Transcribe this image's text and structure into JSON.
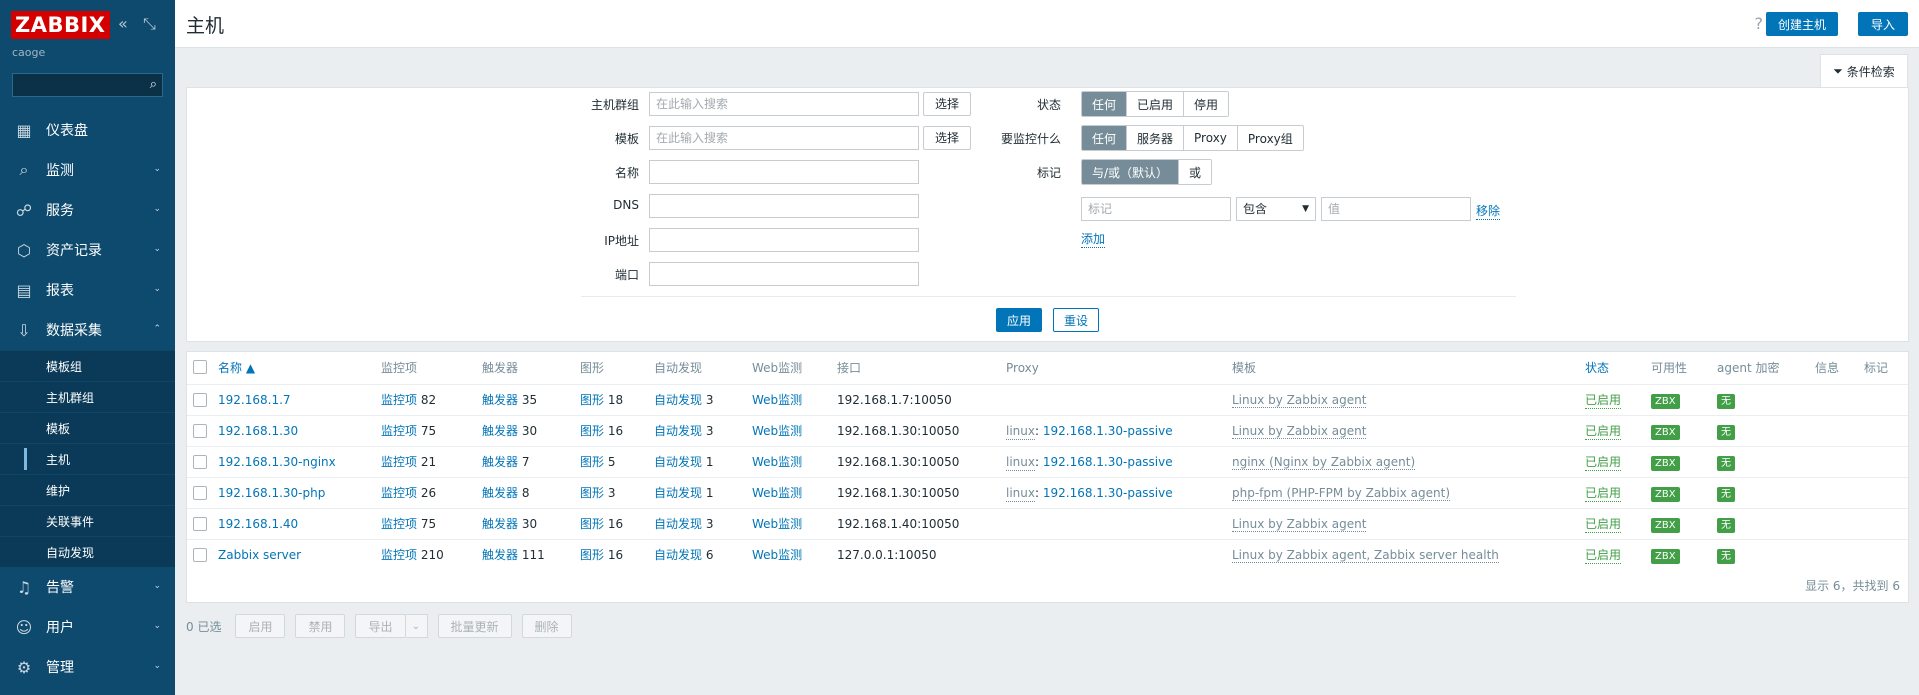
{
  "brand": {
    "logo": "ZABBIX",
    "user": "caoge"
  },
  "sidebar": {
    "items": [
      {
        "label": "仪表盘",
        "icon": "dashboard-icon",
        "chevron": false
      },
      {
        "label": "监测",
        "icon": "monitoring-icon",
        "chevron": true
      },
      {
        "label": "服务",
        "icon": "services-icon",
        "chevron": true
      },
      {
        "label": "资产记录",
        "icon": "inventory-icon",
        "chevron": true
      },
      {
        "label": "报表",
        "icon": "reports-icon",
        "chevron": true
      },
      {
        "label": "数据采集",
        "icon": "data-collection-icon",
        "chevron": true
      }
    ],
    "sub_items": [
      "模板组",
      "主机群组",
      "模板",
      "主机",
      "维护",
      "关联事件",
      "自动发现"
    ],
    "active_sub": "主机",
    "bottom_items": [
      {
        "label": "告警",
        "icon": "bell-icon"
      },
      {
        "label": "用户",
        "icon": "user-icon"
      },
      {
        "label": "管理",
        "icon": "gear-icon"
      }
    ]
  },
  "header": {
    "title": "主机",
    "help": "?",
    "create_label": "创建主机",
    "import_label": "导入"
  },
  "filter": {
    "tab_label": "条件检索",
    "host_groups_label": "主机群组",
    "host_groups_placeholder": "在此输入搜索",
    "templates_label": "模板",
    "templates_placeholder": "在此输入搜索",
    "select_label": "选择",
    "name_label": "名称",
    "dns_label": "DNS",
    "ip_label": "IP地址",
    "port_label": "端口",
    "status_label": "状态",
    "status_options": [
      "任何",
      "已启用",
      "停用"
    ],
    "monitored_by_label": "要监控什么",
    "monitored_by_options": [
      "任何",
      "服务器",
      "Proxy",
      "Proxy组"
    ],
    "tags_label": "标记",
    "tags_options": [
      "与/或（默认）",
      "或"
    ],
    "tag_placeholder": "标记",
    "tag_operator": "包含",
    "tag_value_placeholder": "值",
    "remove_label": "移除",
    "add_label": "添加",
    "apply_label": "应用",
    "reset_label": "重设"
  },
  "table": {
    "headers": [
      "名称 ▲",
      "监控项",
      "触发器",
      "图形",
      "自动发现",
      "Web监测",
      "接口",
      "Proxy",
      "模板",
      "状态",
      "可用性",
      "agent 加密",
      "信息",
      "标记"
    ],
    "rows": [
      {
        "name": "192.168.1.7",
        "items": "82",
        "triggers": "35",
        "graphs": "18",
        "discovery": "3",
        "interface": "192.168.1.7:10050",
        "proxy_prefix": "",
        "proxy": "",
        "template": "Linux by Zabbix agent",
        "status": "已启用",
        "avail": "ZBX",
        "enc": "无"
      },
      {
        "name": "192.168.1.30",
        "items": "75",
        "triggers": "30",
        "graphs": "16",
        "discovery": "3",
        "interface": "192.168.1.30:10050",
        "proxy_prefix": "linux",
        "proxy": "192.168.1.30-passive",
        "template": "Linux by Zabbix agent",
        "status": "已启用",
        "avail": "ZBX",
        "enc": "无"
      },
      {
        "name": "192.168.1.30-nginx",
        "items": "21",
        "triggers": "7",
        "graphs": "5",
        "discovery": "1",
        "interface": "192.168.1.30:10050",
        "proxy_prefix": "linux",
        "proxy": "192.168.1.30-passive",
        "template": "nginx (Nginx by Zabbix agent)",
        "status": "已启用",
        "avail": "ZBX",
        "enc": "无"
      },
      {
        "name": "192.168.1.30-php",
        "items": "26",
        "triggers": "8",
        "graphs": "3",
        "discovery": "1",
        "interface": "192.168.1.30:10050",
        "proxy_prefix": "linux",
        "proxy": "192.168.1.30-passive",
        "template": "php-fpm (PHP-FPM by Zabbix agent)",
        "status": "已启用",
        "avail": "ZBX",
        "enc": "无"
      },
      {
        "name": "192.168.1.40",
        "items": "75",
        "triggers": "30",
        "graphs": "16",
        "discovery": "3",
        "interface": "192.168.1.40:10050",
        "proxy_prefix": "",
        "proxy": "",
        "template": "Linux by Zabbix agent",
        "status": "已启用",
        "avail": "ZBX",
        "enc": "无"
      },
      {
        "name": "Zabbix server",
        "items": "210",
        "triggers": "111",
        "graphs": "16",
        "discovery": "6",
        "interface": "127.0.0.1:10050",
        "proxy_prefix": "",
        "proxy": "",
        "template": "Linux by Zabbix agent, Zabbix server health",
        "status": "已启用",
        "avail": "ZBX",
        "enc": "无"
      }
    ],
    "link_labels": {
      "items": "监控项",
      "triggers": "触发器",
      "graphs": "图形",
      "discovery": "自动发现",
      "web": "Web监测"
    },
    "footer": "显示 6，共找到 6"
  },
  "actions": {
    "selected": "0 已选",
    "enable": "启用",
    "disable": "禁用",
    "export": "导出",
    "mass_update": "批量更新",
    "delete": "删除"
  },
  "colors": {
    "sidebar": "#0e4a6e",
    "accent": "#0275b8",
    "ok": "#429e47",
    "logo": "#d40000"
  }
}
